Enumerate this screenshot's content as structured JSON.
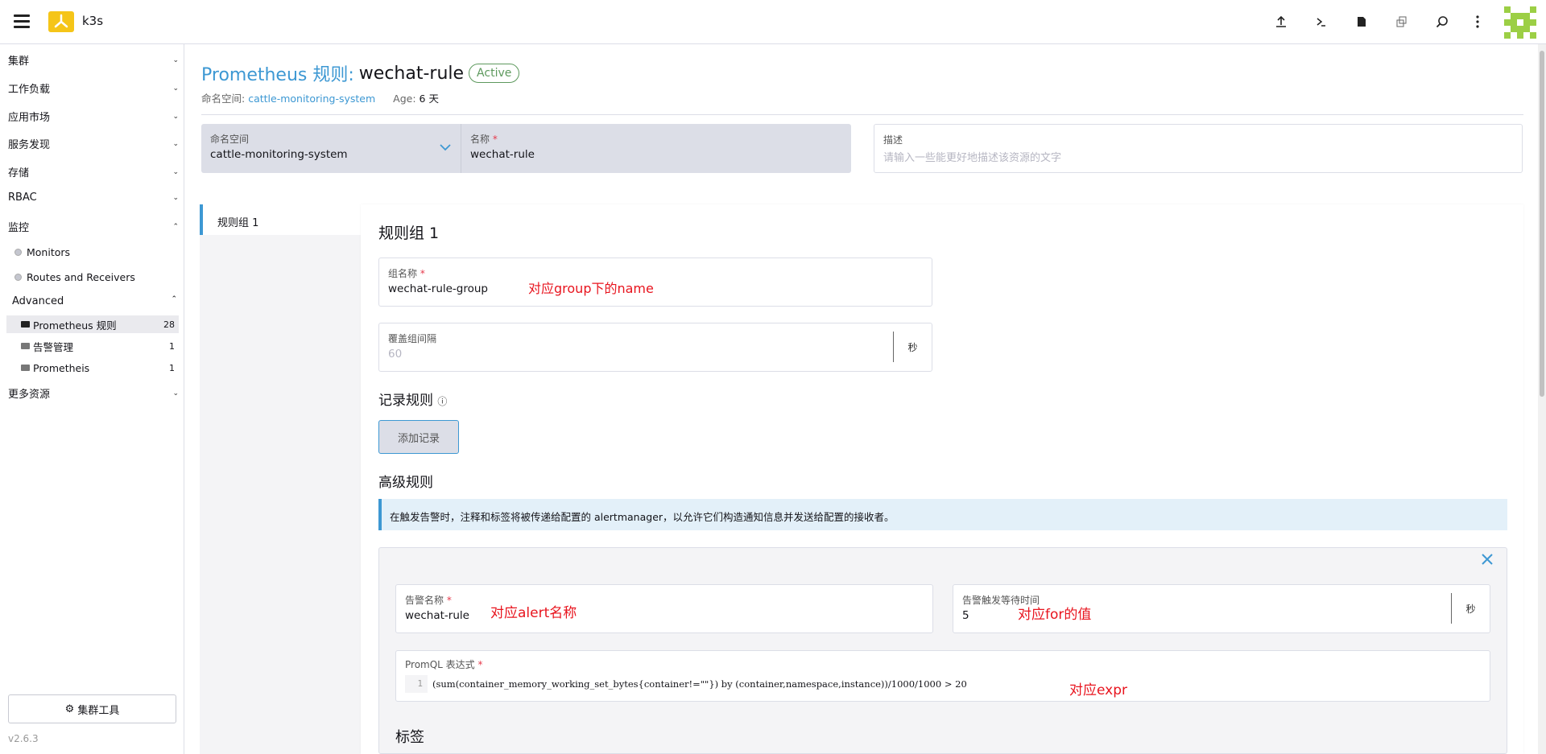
{
  "app": {
    "title": "k3s",
    "version": "v2.6.3"
  },
  "sidebar": {
    "groups": [
      {
        "label": "集群"
      },
      {
        "label": "工作负载"
      },
      {
        "label": "应用市场"
      },
      {
        "label": "服务发现"
      },
      {
        "label": "存储"
      },
      {
        "label": "RBAC"
      },
      {
        "label": "监控"
      }
    ],
    "monitoring_items": [
      {
        "label": "Monitors"
      },
      {
        "label": "Routes and Receivers"
      }
    ],
    "advanced": {
      "label": "Advanced",
      "items": [
        {
          "label": "Prometheus 规则",
          "count": "28"
        },
        {
          "label": "告警管理",
          "count": "1"
        },
        {
          "label": "Prometheis",
          "count": "1"
        }
      ]
    },
    "more_resources": "更多资源",
    "cluster_tools": "集群工具"
  },
  "header": {
    "kind": "Prometheus 规则:",
    "name": "wechat-rule",
    "status": "Active",
    "namespace_label": "命名空间:",
    "namespace_value": "cattle-monitoring-system",
    "age_label": "Age:",
    "age_value": "6 天"
  },
  "form": {
    "namespace_label": "命名空间",
    "namespace_value": "cattle-monitoring-system",
    "name_label": "名称",
    "name_value": "wechat-rule",
    "description_label": "描述",
    "description_placeholder": "请输入一些能更好地描述该资源的文字"
  },
  "tabs": [
    {
      "label": "规则组 1"
    }
  ],
  "group": {
    "title": "规则组 1",
    "group_name_label": "组名称",
    "group_name_value": "wechat-rule-group",
    "interval_label": "覆盖组间隔",
    "interval_placeholder": "60",
    "interval_unit": "秒",
    "recording_rules_title": "记录规则",
    "add_record_button": "添加记录",
    "alerting_rules_title": "高级规则",
    "info_text": "在触发告警时，注释和标签将被传递给配置的 alertmanager，以允许它们构造通知信息并发送给配置的接收者。",
    "alert_name_label": "告警名称",
    "alert_name_value": "wechat-rule",
    "for_label": "告警触发等待时间",
    "for_value": "5",
    "for_unit": "秒",
    "promql_label": "PromQL 表达式",
    "promql_line_no": "1",
    "promql_expr": "(sum(container_memory_working_set_bytes{container!=\"\"}) by (container,namespace,instance))/1000/1000 > 20",
    "labels_title": "标签"
  },
  "annotations": {
    "group_name": "对应group下的name",
    "alert_name": "对应alert名称",
    "for_value": "对应for的值",
    "expr": "对应expr"
  },
  "colors": {
    "accent": "#3d98d3",
    "annotation": "#e8141e",
    "active": "#5d995d"
  }
}
